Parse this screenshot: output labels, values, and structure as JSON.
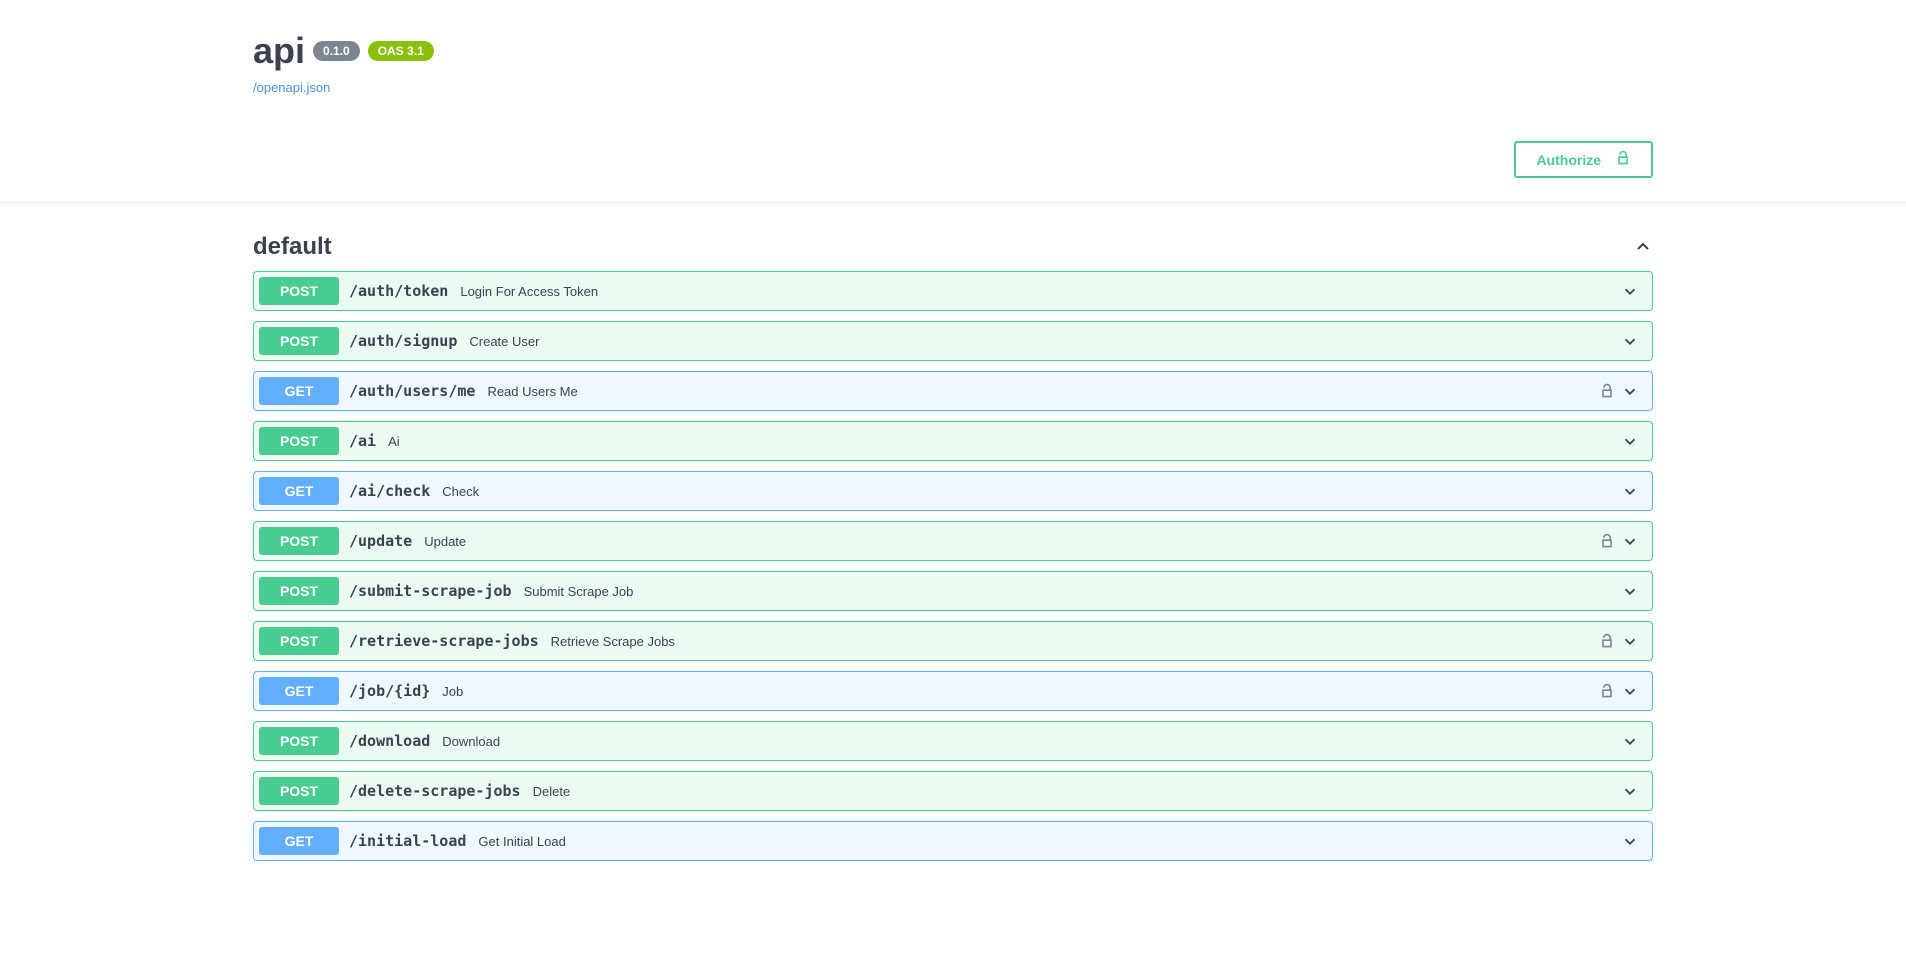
{
  "header": {
    "title": "api",
    "version": "0.1.0",
    "oas": "OAS 3.1",
    "spec_link": "/openapi.json"
  },
  "auth": {
    "authorize_label": "Authorize"
  },
  "section": {
    "title": "default"
  },
  "operations": [
    {
      "method": "POST",
      "path": "/auth/token",
      "summary": "Login For Access Token",
      "locked": false
    },
    {
      "method": "POST",
      "path": "/auth/signup",
      "summary": "Create User",
      "locked": false
    },
    {
      "method": "GET",
      "path": "/auth/users/me",
      "summary": "Read Users Me",
      "locked": true
    },
    {
      "method": "POST",
      "path": "/ai",
      "summary": "Ai",
      "locked": false
    },
    {
      "method": "GET",
      "path": "/ai/check",
      "summary": "Check",
      "locked": false
    },
    {
      "method": "POST",
      "path": "/update",
      "summary": "Update",
      "locked": true
    },
    {
      "method": "POST",
      "path": "/submit-scrape-job",
      "summary": "Submit Scrape Job",
      "locked": false
    },
    {
      "method": "POST",
      "path": "/retrieve-scrape-jobs",
      "summary": "Retrieve Scrape Jobs",
      "locked": true
    },
    {
      "method": "GET",
      "path": "/job/{id}",
      "summary": "Job",
      "locked": true
    },
    {
      "method": "POST",
      "path": "/download",
      "summary": "Download",
      "locked": false
    },
    {
      "method": "POST",
      "path": "/delete-scrape-jobs",
      "summary": "Delete",
      "locked": false
    },
    {
      "method": "GET",
      "path": "/initial-load",
      "summary": "Get Initial Load",
      "locked": false
    }
  ]
}
